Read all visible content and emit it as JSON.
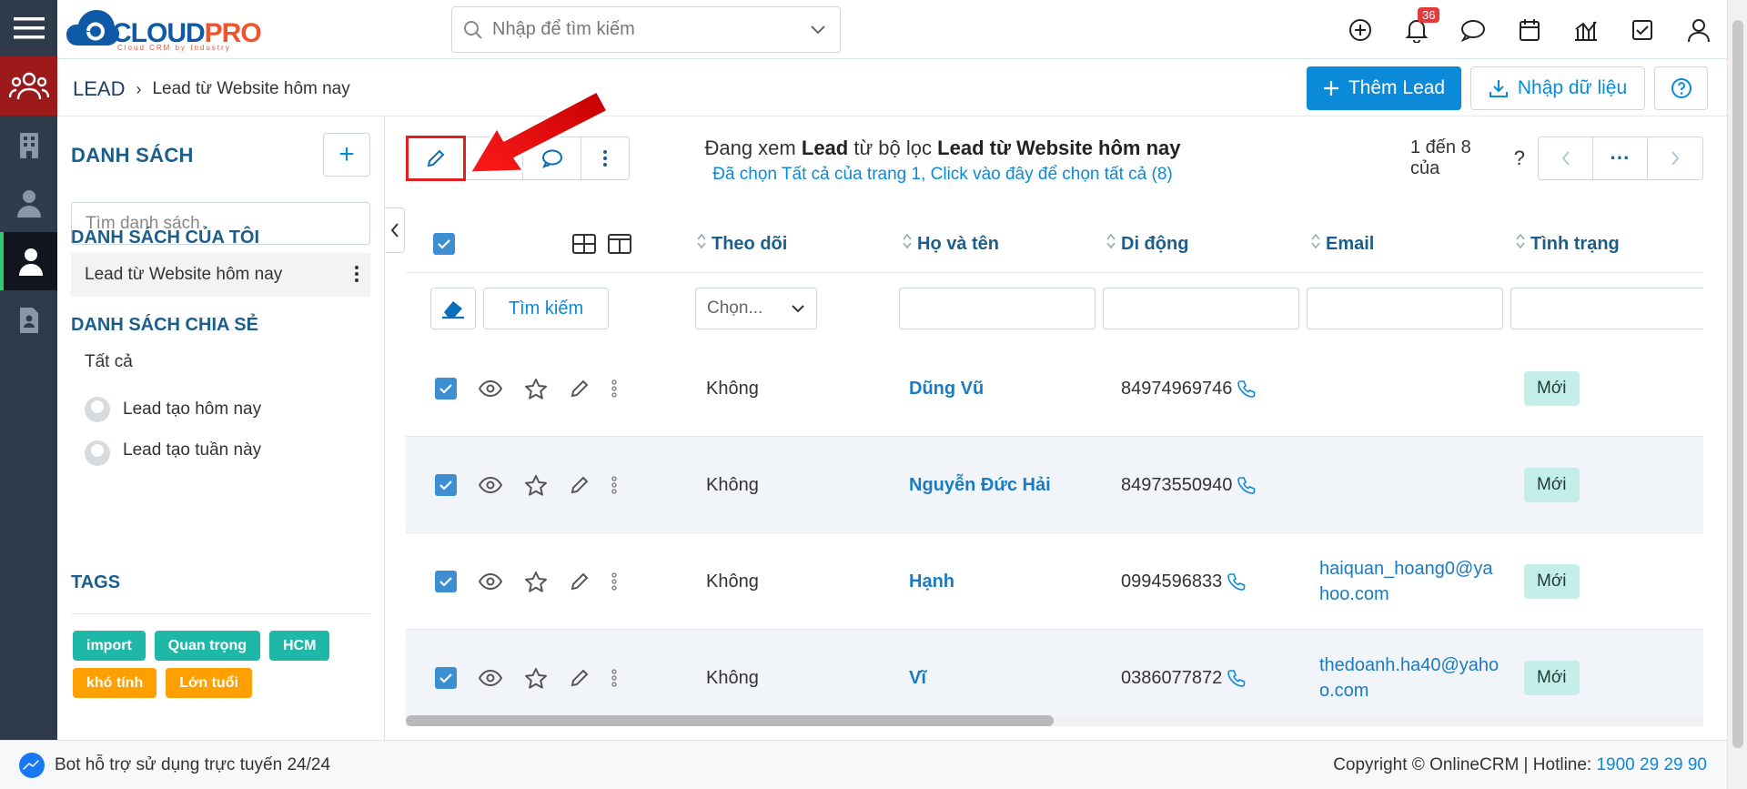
{
  "app": {
    "logo_text_a": "CLOUD",
    "logo_text_b": "PRO",
    "logo_sub": "Cloud CRM by Industry"
  },
  "top_search": {
    "placeholder": "Nhập để tìm kiếm"
  },
  "notifications": {
    "count": "36"
  },
  "breadcrumb": {
    "module": "LEAD",
    "current": "Lead từ Website hôm nay"
  },
  "header_buttons": {
    "add_lead": "Thêm Lead",
    "import": "Nhập dữ liệu"
  },
  "list_panel": {
    "title": "DANH SÁCH",
    "search_placeholder": "Tìm danh sách",
    "my_lists_heading": "DANH SÁCH CỦA TÔI",
    "my_lists": [
      {
        "label": "Lead từ Website hôm nay"
      }
    ],
    "shared_heading": "DANH SÁCH CHIA SẺ",
    "shared": [
      {
        "label": "Tất cả"
      },
      {
        "label": "Lead tạo hôm nay"
      },
      {
        "label": "Lead tạo tuần này"
      }
    ],
    "tags_heading": "TAGS",
    "tags": [
      {
        "label": "import",
        "color": "#1fb8a8"
      },
      {
        "label": "Quan trọng",
        "color": "#1fb8a8"
      },
      {
        "label": "HCM",
        "color": "#1fb8a8"
      },
      {
        "label": "khó tính",
        "color": "#ff9f00"
      },
      {
        "label": "Lớn tuổi",
        "color": "#ff9f00"
      }
    ]
  },
  "viewing": {
    "prefix": "Đang xem",
    "module": "Lead",
    "middle": "từ bộ lọc",
    "filter": "Lead từ Website hôm nay",
    "selection_note": "Đã chọn Tất cả của trang 1, Click vào đây để chọn tất cả (8)"
  },
  "pager": {
    "label": "1 đến 8 của",
    "unknown": "?",
    "more": "···"
  },
  "table": {
    "columns": [
      "Theo dõi",
      "Họ và tên",
      "Di động",
      "Email",
      "Tình trạng"
    ],
    "search_button": "Tìm kiếm",
    "select_placeholder": "Chọn...",
    "rows": [
      {
        "follow": "Không",
        "name": "Dũng Vũ",
        "mobile": "84974969746",
        "email": "",
        "status": "Mới"
      },
      {
        "follow": "Không",
        "name": "Nguyễn Đức Hải",
        "mobile": "84973550940",
        "email": "",
        "status": "Mới"
      },
      {
        "follow": "Không",
        "name": "Hạnh",
        "mobile": "0994596833",
        "email": "haiquan_hoang0@yahoo.com",
        "status": "Mới"
      },
      {
        "follow": "Không",
        "name": "Vĩ",
        "mobile": "0386077872",
        "email": "thedoanh.ha40@yahoo.com",
        "status": "Mới"
      }
    ]
  },
  "footer": {
    "bot_text": "Bot hỗ trợ sử dụng trực tuyến 24/24",
    "copyright": "Copyright © OnlineCRM",
    "hotline_label": "Hotline:",
    "hotline": "1900 29 29 90"
  },
  "colors": {
    "accent": "#0a8ad8",
    "rail": "#2f3a4a",
    "leads_active": "#9c1a1a",
    "highlight_box": "#e01f1f"
  }
}
